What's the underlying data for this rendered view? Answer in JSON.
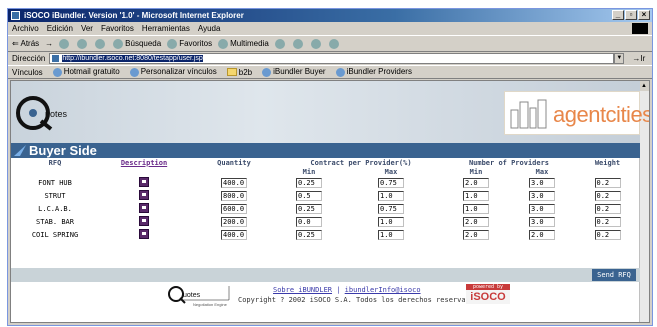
{
  "window": {
    "title": "iSOCO iBundler. Version '1.0' - Microsoft Internet Explorer",
    "controls": [
      "_",
      "▫",
      "×"
    ]
  },
  "menu": [
    "Archivo",
    "Edición",
    "Ver",
    "Favoritos",
    "Herramientas",
    "Ayuda"
  ],
  "toolbar": {
    "back": "⇐ Atrás",
    "search": "Búsqueda",
    "favorites": "Favoritos",
    "multimedia": "Multimedia"
  },
  "address": {
    "label": "Dirección",
    "url": "http://ibundler.isoco.net:8080/testapp/user.jsp",
    "go": "Ir"
  },
  "links": {
    "label": "Vínculos",
    "items": [
      "Hotmail gratuito",
      "Personalizar vínculos",
      "b2b",
      "iBundler Buyer",
      "iBundler Providers"
    ]
  },
  "page": {
    "brand_right": "agentcities",
    "section_title": "Buyer Side",
    "headers": {
      "rfq": "RFQ",
      "description": "Description",
      "quantity": "Quantity",
      "contract": "Contract per Provider(%)",
      "providers": "Number of Providers",
      "weight": "Weight",
      "min": "Min",
      "max": "Max"
    },
    "rows": [
      {
        "rfq": "FONT HUB",
        "quantity": "400.0",
        "c_min": "0.25",
        "c_max": "0.75",
        "p_min": "2.0",
        "p_max": "3.0",
        "weight": "0.2"
      },
      {
        "rfq": "STRUT",
        "quantity": "800.0",
        "c_min": "0.5",
        "c_max": "1.0",
        "p_min": "1.0",
        "p_max": "3.0",
        "weight": "0.2"
      },
      {
        "rfq": "L.C.A.B.",
        "quantity": "600.0",
        "c_min": "0.25",
        "c_max": "0.75",
        "p_min": "1.0",
        "p_max": "3.0",
        "weight": "0.2"
      },
      {
        "rfq": "STAB. BAR",
        "quantity": "200.0",
        "c_min": "0.0",
        "c_max": "1.0",
        "p_min": "2.0",
        "p_max": "3.0",
        "weight": "0.2"
      },
      {
        "rfq": "COIL SPRING",
        "quantity": "400.0",
        "c_min": "0.25",
        "c_max": "1.0",
        "p_min": "2.0",
        "p_max": "2.0",
        "weight": "0.2"
      }
    ],
    "send_label": "Send RFQ",
    "footer": {
      "link1": "Sobre iBUNDLER",
      "separator": "|",
      "link2": "ibundlerInfo@isoco",
      "copyright": "Copyright ? 2002 iSOCO S.A. Todos los derechos reservados",
      "powered_by": "powered by",
      "isoco": "iSOCO"
    }
  }
}
